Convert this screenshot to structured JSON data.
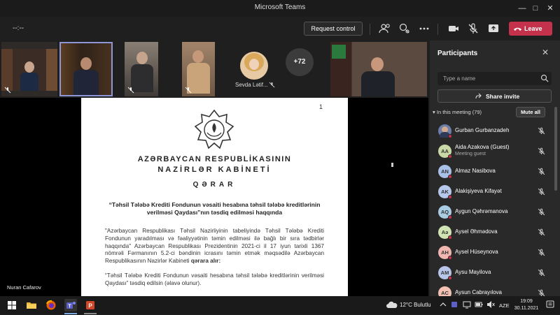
{
  "window": {
    "title": "Microsoft Teams"
  },
  "call": {
    "timer": "--:--",
    "request_control_label": "Request control",
    "leave_label": "Leave"
  },
  "video_strip": {
    "named_tile": "Sevda Lətif...",
    "more_count": "+72"
  },
  "shared_doc": {
    "page_mark": "1",
    "heading_line1": "AZƏRBAYCAN RESPUBLİKASININ",
    "heading_line2": "NAZİRLƏR KABİNETİ",
    "heading_line3": "QƏRAR",
    "subject": "“Təhsil Tələbə Krediti Fondunun vəsaiti hesabına təhsil tələbə kreditlərinin verilməsi Qaydası”nın təsdiq edilməsi haqqında",
    "body_para1_a": "\"Azərbaycan Respublikası Təhsil Nazirliyinin tabeliyində Təhsil Tələbə Krediti Fondunun yaradılması və fəaliyyətinin təmin edilməsi ilə bağlı bir sıra tədbirlər haqqında\" Azərbaycan Respublikası Prezidentinin 2021-ci il 17 iyun tarixli 1367 nömrəli Fərmanının 5.2-ci bəndinin icrasını təmin etmək məqsədilə Azərbaycan Respublikasının Nazirlər Kabineti ",
    "body_para1_bold": "qərara alır:",
    "body_para2": "“Təhsil Tələbə Krediti Fondunun vəsaiti hesabına təhsil tələbə kreditlərinin verilməsi Qaydası” təsdiq edilsin (əlavə olunur).",
    "presenter": "Nuran Cafarov"
  },
  "participants": {
    "title": "Participants",
    "search_placeholder": "Type a name",
    "share_invite_label": "Share invite",
    "in_meeting_label": "In this meeting (79)",
    "mute_all_label": "Mute all",
    "list": [
      {
        "initials": "",
        "name": "Gurban Gurbanzadeh",
        "sub": "",
        "color": "#6b7fa8"
      },
      {
        "initials": "AA",
        "name": "Aida Azakova (Guest)",
        "sub": "Meeting guest",
        "color": "#c9d9a6"
      },
      {
        "initials": "AN",
        "name": "Almaz Nasibova",
        "sub": "",
        "color": "#a9c1e8"
      },
      {
        "initials": "AK",
        "name": "Alakişiyeva Kifayət",
        "sub": "",
        "color": "#b5c7ea"
      },
      {
        "initials": "AQ",
        "name": "Aygun Qəhrəmanova",
        "sub": "",
        "color": "#a9cce3"
      },
      {
        "initials": "Aə",
        "name": "Aysel Əhmədova",
        "sub": "",
        "color": "#cfe3b3"
      },
      {
        "initials": "AH",
        "name": "Aysel Hüseynova",
        "sub": "",
        "color": "#f0b6b0"
      },
      {
        "initials": "AM",
        "name": "Aysu Mayilova",
        "sub": "",
        "color": "#b7c6e8"
      },
      {
        "initials": "AC",
        "name": "Aysun Cabrayılova",
        "sub": "",
        "color": "#f2c1b4"
      }
    ]
  },
  "taskbar": {
    "weather": "12°C  Bulutlu",
    "lang": "AZE",
    "time": "19:09",
    "date": "30.11.2021"
  },
  "colors": {
    "leave": "#c4314b",
    "panel": "#292929",
    "accent": "#7aa8e0"
  }
}
